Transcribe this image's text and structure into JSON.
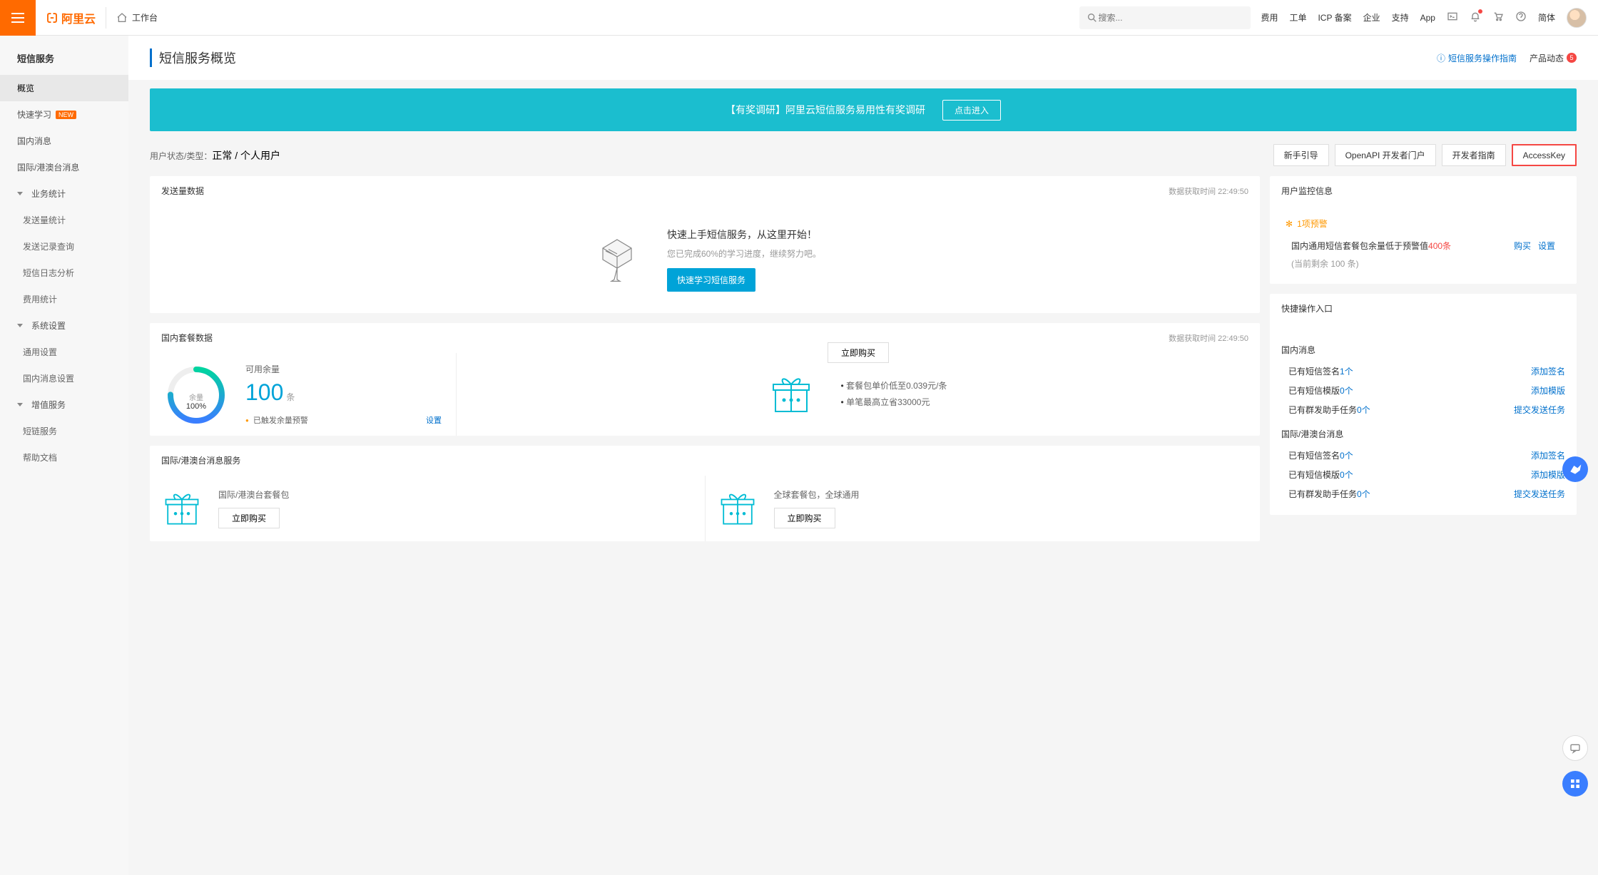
{
  "topbar": {
    "brand": "阿里云",
    "workbench": "工作台",
    "search_placeholder": "搜索...",
    "links": [
      "费用",
      "工单",
      "ICP 备案",
      "企业",
      "支持",
      "App"
    ],
    "simple": "简体",
    "news_badge": "5"
  },
  "sidebar": {
    "title": "短信服务",
    "items": [
      "概览",
      "快速学习",
      "国内消息",
      "国际/港澳台消息"
    ],
    "new_tag": "NEW",
    "group_stats": "业务统计",
    "stats_items": [
      "发送量统计",
      "发送记录查询",
      "短信日志分析",
      "费用统计"
    ],
    "group_system": "系统设置",
    "system_items": [
      "通用设置",
      "国内消息设置"
    ],
    "group_value": "增值服务",
    "value_items": [
      "短链服务",
      "帮助文档"
    ]
  },
  "page": {
    "title": "短信服务概览",
    "guide_link": "短信服务操作指南",
    "product_news": "产品动态",
    "product_news_count": "5"
  },
  "banner": {
    "text": "【有奖调研】阿里云短信服务易用性有奖调研",
    "btn": "点击进入"
  },
  "status": {
    "label": "用户状态/类型：",
    "value": "正常 / 个人用户",
    "buttons": [
      "新手引导",
      "OpenAPI 开发者门户",
      "开发者指南",
      "AccessKey"
    ]
  },
  "send_card": {
    "title": "发送量数据",
    "timestamp": "数据获取时间 22:49:50",
    "quickstart_title": "快速上手短信服务，从这里开始！",
    "quickstart_sub": "您已完成60%的学习进度，继续努力吧。",
    "quickstart_btn": "快速学习短信服务"
  },
  "package_card": {
    "title": "国内套餐数据",
    "timestamp": "数据获取时间 22:49:50",
    "gauge_top": "余量",
    "gauge_pct": "100%",
    "avail_label": "可用余量",
    "avail_value": "100",
    "avail_unit": "条",
    "alert_text": "已触发余量预警",
    "alert_link": "设置",
    "buy_now": "立即购买",
    "bullets": [
      "套餐包单价低至0.039元/条",
      "单笔最高立省33000元"
    ]
  },
  "intl_card": {
    "title": "国际/港澳台消息服务",
    "item1": "国际/港澳台套餐包",
    "item2": "全球套餐包，全球通用",
    "buy1": "立即购买",
    "buy2": "立即购买"
  },
  "monitor": {
    "title": "用户监控信息",
    "warn": "1项预警",
    "alert_text_a": "国内通用短信套餐包余量低于预警值",
    "alert_text_b": "400条",
    "alert_sub": "(当前剩余 100 条)",
    "link_buy": "购买",
    "link_set": "设置"
  },
  "quick": {
    "title": "快捷操作入口",
    "domestic": "国内消息",
    "rows_d": [
      {
        "label": "已有短信签名",
        "count": "1个",
        "link": "添加签名"
      },
      {
        "label": "已有短信模版",
        "count": "0个",
        "link": "添加模版"
      },
      {
        "label": "已有群发助手任务",
        "count": "0个",
        "link": "提交发送任务"
      }
    ],
    "intl": "国际/港澳台消息",
    "rows_i": [
      {
        "label": "已有短信签名",
        "count": "0个",
        "link": "添加签名"
      },
      {
        "label": "已有短信模版",
        "count": "0个",
        "link": "添加模版"
      },
      {
        "label": "已有群发助手任务",
        "count": "0个",
        "link": "提交发送任务"
      }
    ]
  }
}
